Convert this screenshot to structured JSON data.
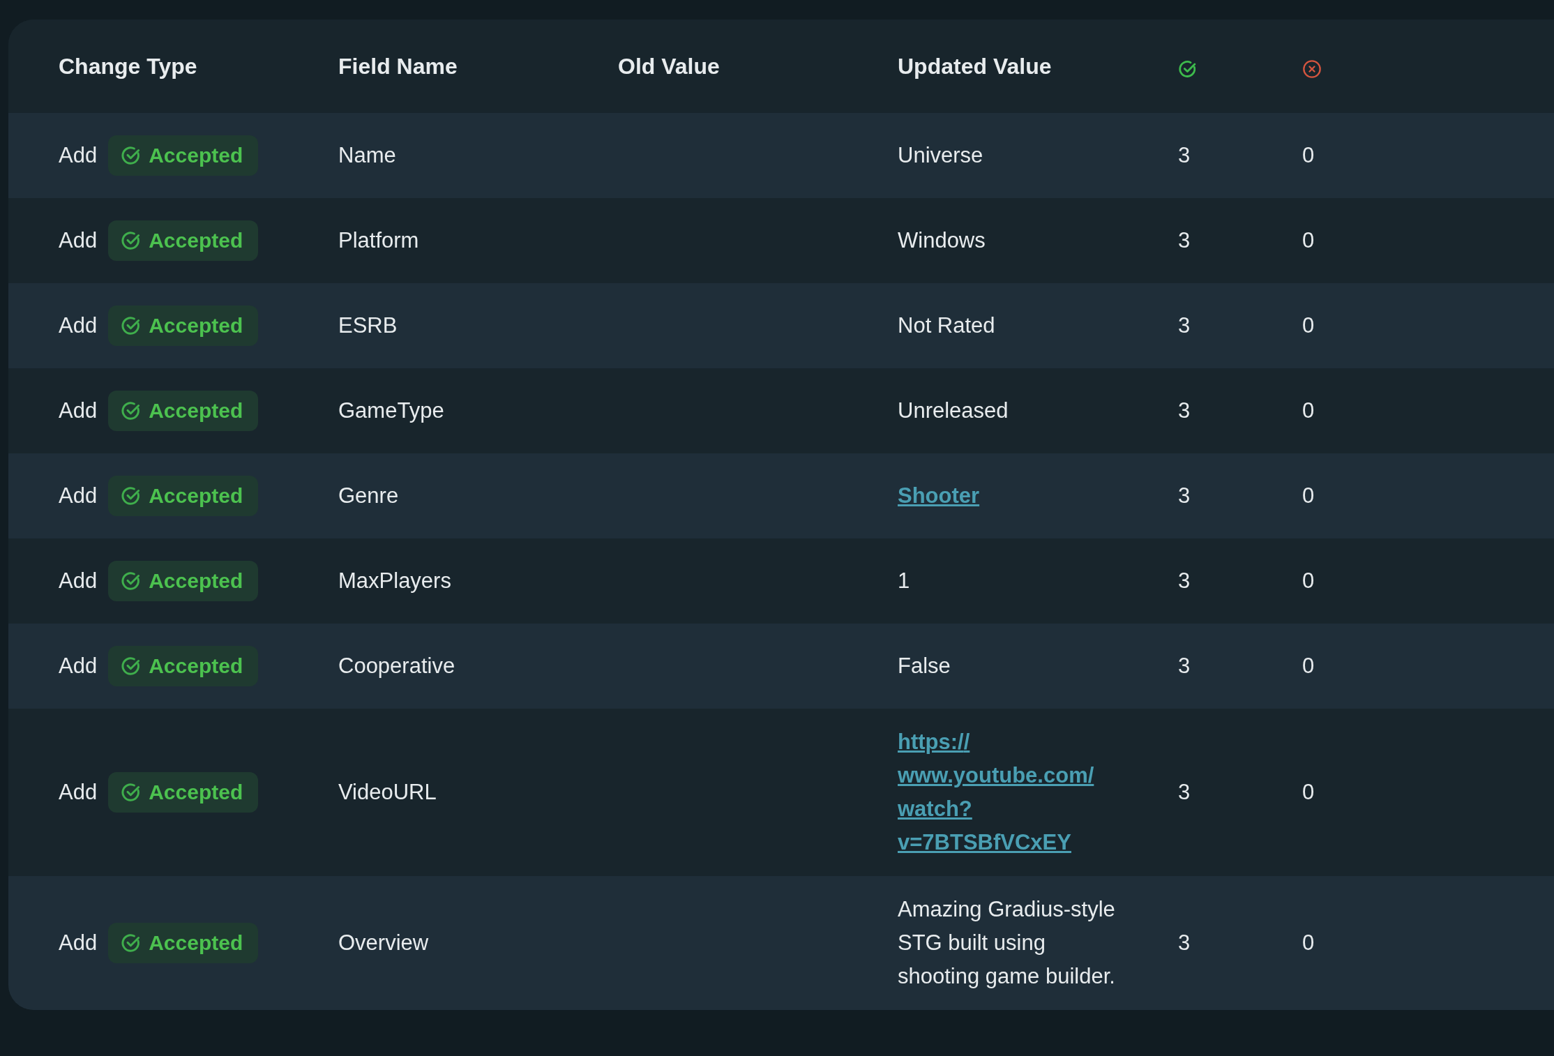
{
  "table": {
    "columns": [
      {
        "kind": "text",
        "label": "Change Type"
      },
      {
        "kind": "text",
        "label": "Field Name"
      },
      {
        "kind": "text",
        "label": "Old Value"
      },
      {
        "kind": "text",
        "label": "Updated Value"
      },
      {
        "kind": "accept-icon"
      },
      {
        "kind": "reject-icon"
      }
    ],
    "rows": [
      {
        "change_type": "Add",
        "status": "Accepted",
        "field": "Name",
        "value": "Universe",
        "kind": "text",
        "accepts": "3",
        "rejects": "0"
      },
      {
        "change_type": "Add",
        "status": "Accepted",
        "field": "Platform",
        "value": "Windows",
        "kind": "text",
        "accepts": "3",
        "rejects": "0"
      },
      {
        "change_type": "Add",
        "status": "Accepted",
        "field": "ESRB",
        "value": "Not Rated",
        "kind": "text",
        "accepts": "3",
        "rejects": "0"
      },
      {
        "change_type": "Add",
        "status": "Accepted",
        "field": "GameType",
        "value": "Unreleased",
        "kind": "text",
        "accepts": "3",
        "rejects": "0"
      },
      {
        "change_type": "Add",
        "status": "Accepted",
        "field": "Genre",
        "value": "Shooter",
        "kind": "link",
        "accepts": "3",
        "rejects": "0"
      },
      {
        "change_type": "Add",
        "status": "Accepted",
        "field": "MaxPlayers",
        "value": "1",
        "kind": "text",
        "accepts": "3",
        "rejects": "0"
      },
      {
        "change_type": "Add",
        "status": "Accepted",
        "field": "Cooperative",
        "value": "False",
        "kind": "text",
        "accepts": "3",
        "rejects": "0"
      },
      {
        "change_type": "Add",
        "status": "Accepted",
        "field": "VideoURL",
        "value": "https://www.youtube.com/watch?v=7BTSBfVCxEY",
        "kind": "link",
        "accepts": "3",
        "rejects": "0"
      },
      {
        "change_type": "Add",
        "status": "Accepted",
        "field": "Overview",
        "value": "Amazing Gradius-style STG built using shooting game builder.",
        "kind": "text",
        "accepts": "3",
        "rejects": "0"
      }
    ]
  }
}
